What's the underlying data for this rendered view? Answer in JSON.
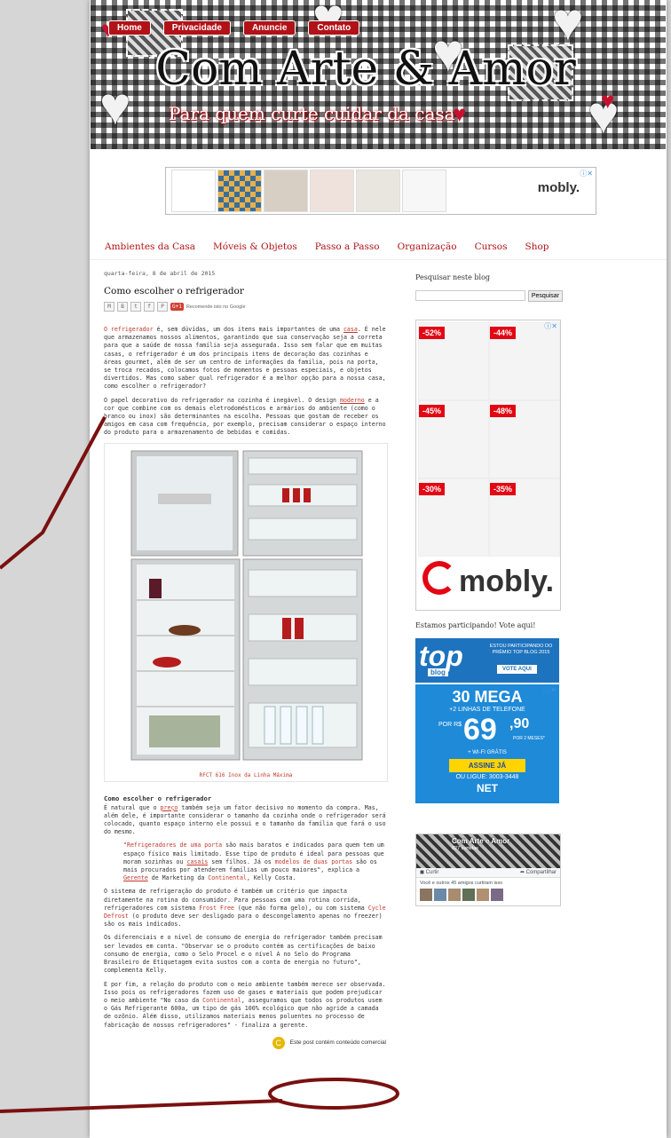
{
  "header": {
    "nav": [
      "Home",
      "Privacidade",
      "Anuncie",
      "Contato"
    ],
    "title": "Com Arte & Amor",
    "tagline": "Para quem curte cuidar da casa"
  },
  "top_ad": {
    "brand": "mobly."
  },
  "menu": [
    "Ambientes da Casa",
    "Móveis & Objetos",
    "Passo a Passo",
    "Organização",
    "Cursos",
    "Shop"
  ],
  "post": {
    "date": "quarta-feira, 8 de abril de 2015",
    "title": "Como escolher o refrigerador",
    "share": {
      "gplus": "G+1",
      "recommend": "Recomende isto no Google"
    },
    "p1_link1": "O refrigerador",
    "p1_a": " é, sem dúvidas, um dos itens mais importantes de uma ",
    "p1_link2": "casa",
    "p1_b": ". É nele que armazenamos nossos alimentos, garantindo que sua conservação seja a correta para que a saúde de nossa família seja assegurada. Isso sem falar que em muitas casas, o refrigerador é um dos principais itens de decoração das cozinhas e áreas gourmet, além de ser um centro de informações da família, pois na porta, se troca recados, colocamos fotos de momentos e pessoas especiais, e objetos divertidos. Mas como saber qual refrigerador é a melhor opção para a nossa casa, como escolher o refrigerador?",
    "p2_a": "O papel decorativo do refrigerador na cozinha é inegável. O design ",
    "p2_link": "moderno",
    "p2_b": " e a cor que combine com os demais eletrodomésticos e armários do ambiente (como o branco ou inox) são determinantes na escolha. Pessoas que gostam de receber os amigos em casa com frequência, por exemplo, precisam considerar o espaço interno do produto para o armazenamento de bebidas e comidas.",
    "caption": "RFCT 616 Inox da Linha Máxima",
    "h2": "Como escolher o refrigerador",
    "p3_a": "É natural que o ",
    "p3_link1": "preço",
    "p3_b": " também seja um fator decisivo no momento da compra. Mas, além dele, é importante considerar o tamanho da cozinha onde o refrigerador será colocado, quanto espaço interno ele possui e o tamanho da família que fará o uso do mesmo.",
    "q_link1": "\"Refrigeradores de uma porta",
    "q_a": " são mais baratos e indicados para quem tem um espaço físico mais limitado. Esse tipo de produto é ideal para pessoas que moram sozinhas ou ",
    "q_link2": "casais",
    "q_b": " sem filhos. Já os ",
    "q_link3": "modelos de duas portas",
    "q_c": " são os mais procurados por atenderem famílias um pouco maiores\", explica a ",
    "q_link4": "Gerente",
    "q_d": " de Marketing da ",
    "q_link5": "Continental",
    "q_e": ", Kelly Costa.",
    "p4_a": "O sistema de refrigeração do produto é também um critério que impacta diretamente na rotina do consumidor. Para pessoas com uma rotina corrida, refrigeradores com sistema ",
    "p4_link1": "Frost Free",
    "p4_b": " (que não forma gelo), ou com sistema ",
    "p4_link2": "Cycle Defrost",
    "p4_c": " (o produto deve ser desligado para o descongelamento apenas no freezer) são os mais indicados.",
    "p5": "Os diferenciais  e o nível de consumo de energia do refrigerador também precisam ser levados em conta. \"Observar se o produto contém as certificações de baixo consumo de energia, como o Selo Procel e o nível A no Selo do Programa Brasileiro de Etiquetagem evita sustos com a conta de energia no futuro\", complementa Kelly.",
    "p6_a": "E por fim, a relação do produto com o meio ambiente também merece ser observada. Isso pois os refrigeradores fazem uso de gases e materiais que podem  prejudicar o meio ambiente \"No caso da ",
    "p6_link": "Continental",
    "p6_b": ", asseguramos que todos os produtos usem o Gás Refrigerante 600a, um tipo de gás  100% ecológico que  não agride a camada de ozônio. Além disso, utilizamos materiais  menos poluentes no processo de fabricação de nossos refrigeradores\" - finaliza a gerente.",
    "commercial": "Este post contém conteúdo comercial"
  },
  "sidebar": {
    "search_title": "Pesquisar neste blog",
    "search_button": "Pesquisar",
    "mobly_discounts": [
      "-52%",
      "-44%",
      "-45%",
      "-48%",
      "-30%",
      "-35%"
    ],
    "mobly_brand": "mobly.",
    "vote_title": "Estamos participando! Vote aqui!",
    "topblog": {
      "logo_a": "top",
      "logo_b": "blog",
      "text": "ESTOU PARTICIPANDO DO PRÊMIO TOP BLOG 2015",
      "vote": "VOTE AQUI"
    },
    "net_ad": {
      "mega": "30 MEGA",
      "lines": "+2 LINHAS DE TELEFONE",
      "por": "POR R$",
      "price": "69",
      "cents": ",90",
      "meses": "POR 2 MESES*",
      "wifi": "+ WI-FI GRÁTIS",
      "cta": "ASSINE JÁ",
      "phone": "OU LIGUE: 3003-3448",
      "brand": "NET"
    },
    "facebook": {
      "page_name": "Com Arte e Amor",
      "likes": "827 curtidas",
      "like": "Curtir",
      "share": "Compartilhar",
      "friends": "Você e outros 45 amigos curtiram isso"
    }
  },
  "colors": {
    "accent": "#b11218",
    "link": "#c0392b",
    "annotation": "#7a1010"
  }
}
